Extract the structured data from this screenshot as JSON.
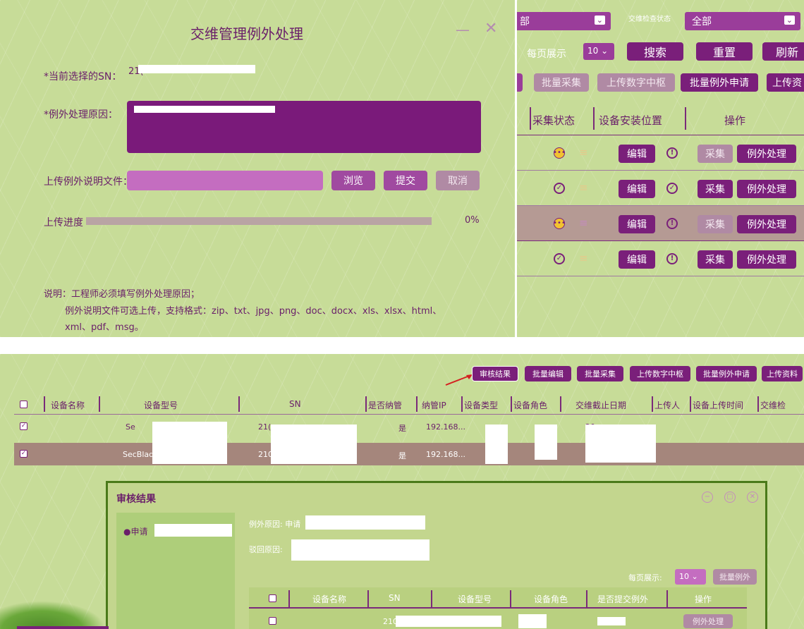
{
  "dialog": {
    "title": "交维管理例外处理",
    "minimize_icon": "minimize-icon",
    "close_icon": "close-icon",
    "sn_label": "*当前选择的SN：",
    "sn_value": "21(",
    "reason_label": "*例外处理原因：",
    "upload_label": "上传例外说明文件：",
    "browse_label": "浏览",
    "submit_label": "提交",
    "cancel_label": "取消",
    "progress_label": "上传进度",
    "progress_value": 0,
    "progress_text": "0%",
    "note_line1": "说明：工程师必须填写例外处理原因；",
    "note_line2": "例外说明文件可选上传，支持格式：zip、txt、jpg、png、doc、docx、xls、xlsx、html、",
    "note_line3": "xml、pdf、msg。"
  },
  "right_panel": {
    "filter1_value": "部",
    "filter2_label": "交维检查状态",
    "filter2_value": "全部",
    "per_page_label": "每页展示",
    "per_page_value": "10",
    "search_label": "搜索",
    "reset_label": "重置",
    "refresh_label": "刷新",
    "batch_collect_label": "批量采集",
    "upload_digital_label": "上传数字中枢",
    "batch_exception_label": "批量例外申请",
    "upload_data_label": "上传资",
    "col_collect_status": "采集状态",
    "col_install_location": "设备安装位置",
    "col_operation": "操作",
    "rows": [
      {
        "status": "pending",
        "edit": "编辑",
        "loc": "alert",
        "collect": "采集",
        "exception": "例外处理",
        "collect_enabled": false
      },
      {
        "status": "ok",
        "edit": "编辑",
        "loc": "ok",
        "collect": "采集",
        "exception": "例外处理",
        "collect_enabled": true
      },
      {
        "status": "pending",
        "edit": "编辑",
        "loc": "alert",
        "collect": "采集",
        "exception": "例外处理",
        "collect_enabled": false
      },
      {
        "status": "ok",
        "edit": "编辑",
        "loc": "alert",
        "collect": "采集",
        "exception": "例外处理",
        "collect_enabled": true
      }
    ]
  },
  "bottom": {
    "toolbar": [
      "审核结果",
      "批量编辑",
      "批量采集",
      "上传数字中枢",
      "批量例外申请",
      "上传资料"
    ],
    "columns": [
      "设备名称",
      "设备型号",
      "SN",
      "是否纳管",
      "纳管IP",
      "设备类型",
      "设备角色",
      "交维截止日期",
      "上传人",
      "设备上传时间",
      "交维检"
    ],
    "rows": [
      {
        "model": "Se",
        "sn": "21(",
        "managed": "是",
        "ip": "192.168...",
        "date": "20"
      },
      {
        "name": "SecBlad",
        "sn": "210",
        "managed": "是",
        "ip": "192.168...",
        "date": "20"
      }
    ],
    "review": {
      "title": "审核结果",
      "list_item": "●申请",
      "reason_label": "例外原因: 申请",
      "reject_label": "驳回原因:",
      "per_page_label": "每页展示:",
      "per_page_value": "10",
      "batch_label": "批量例外",
      "columns": [
        "设备名称",
        "SN",
        "设备型号",
        "设备角色",
        "是否提交例外",
        "操作"
      ],
      "row_sn": "210",
      "row_action": "例外处理"
    }
  },
  "colors": {
    "accent_dark": "#7a1f7a",
    "accent_mid": "#a04aa0",
    "bg_green": "#c7dc98"
  }
}
